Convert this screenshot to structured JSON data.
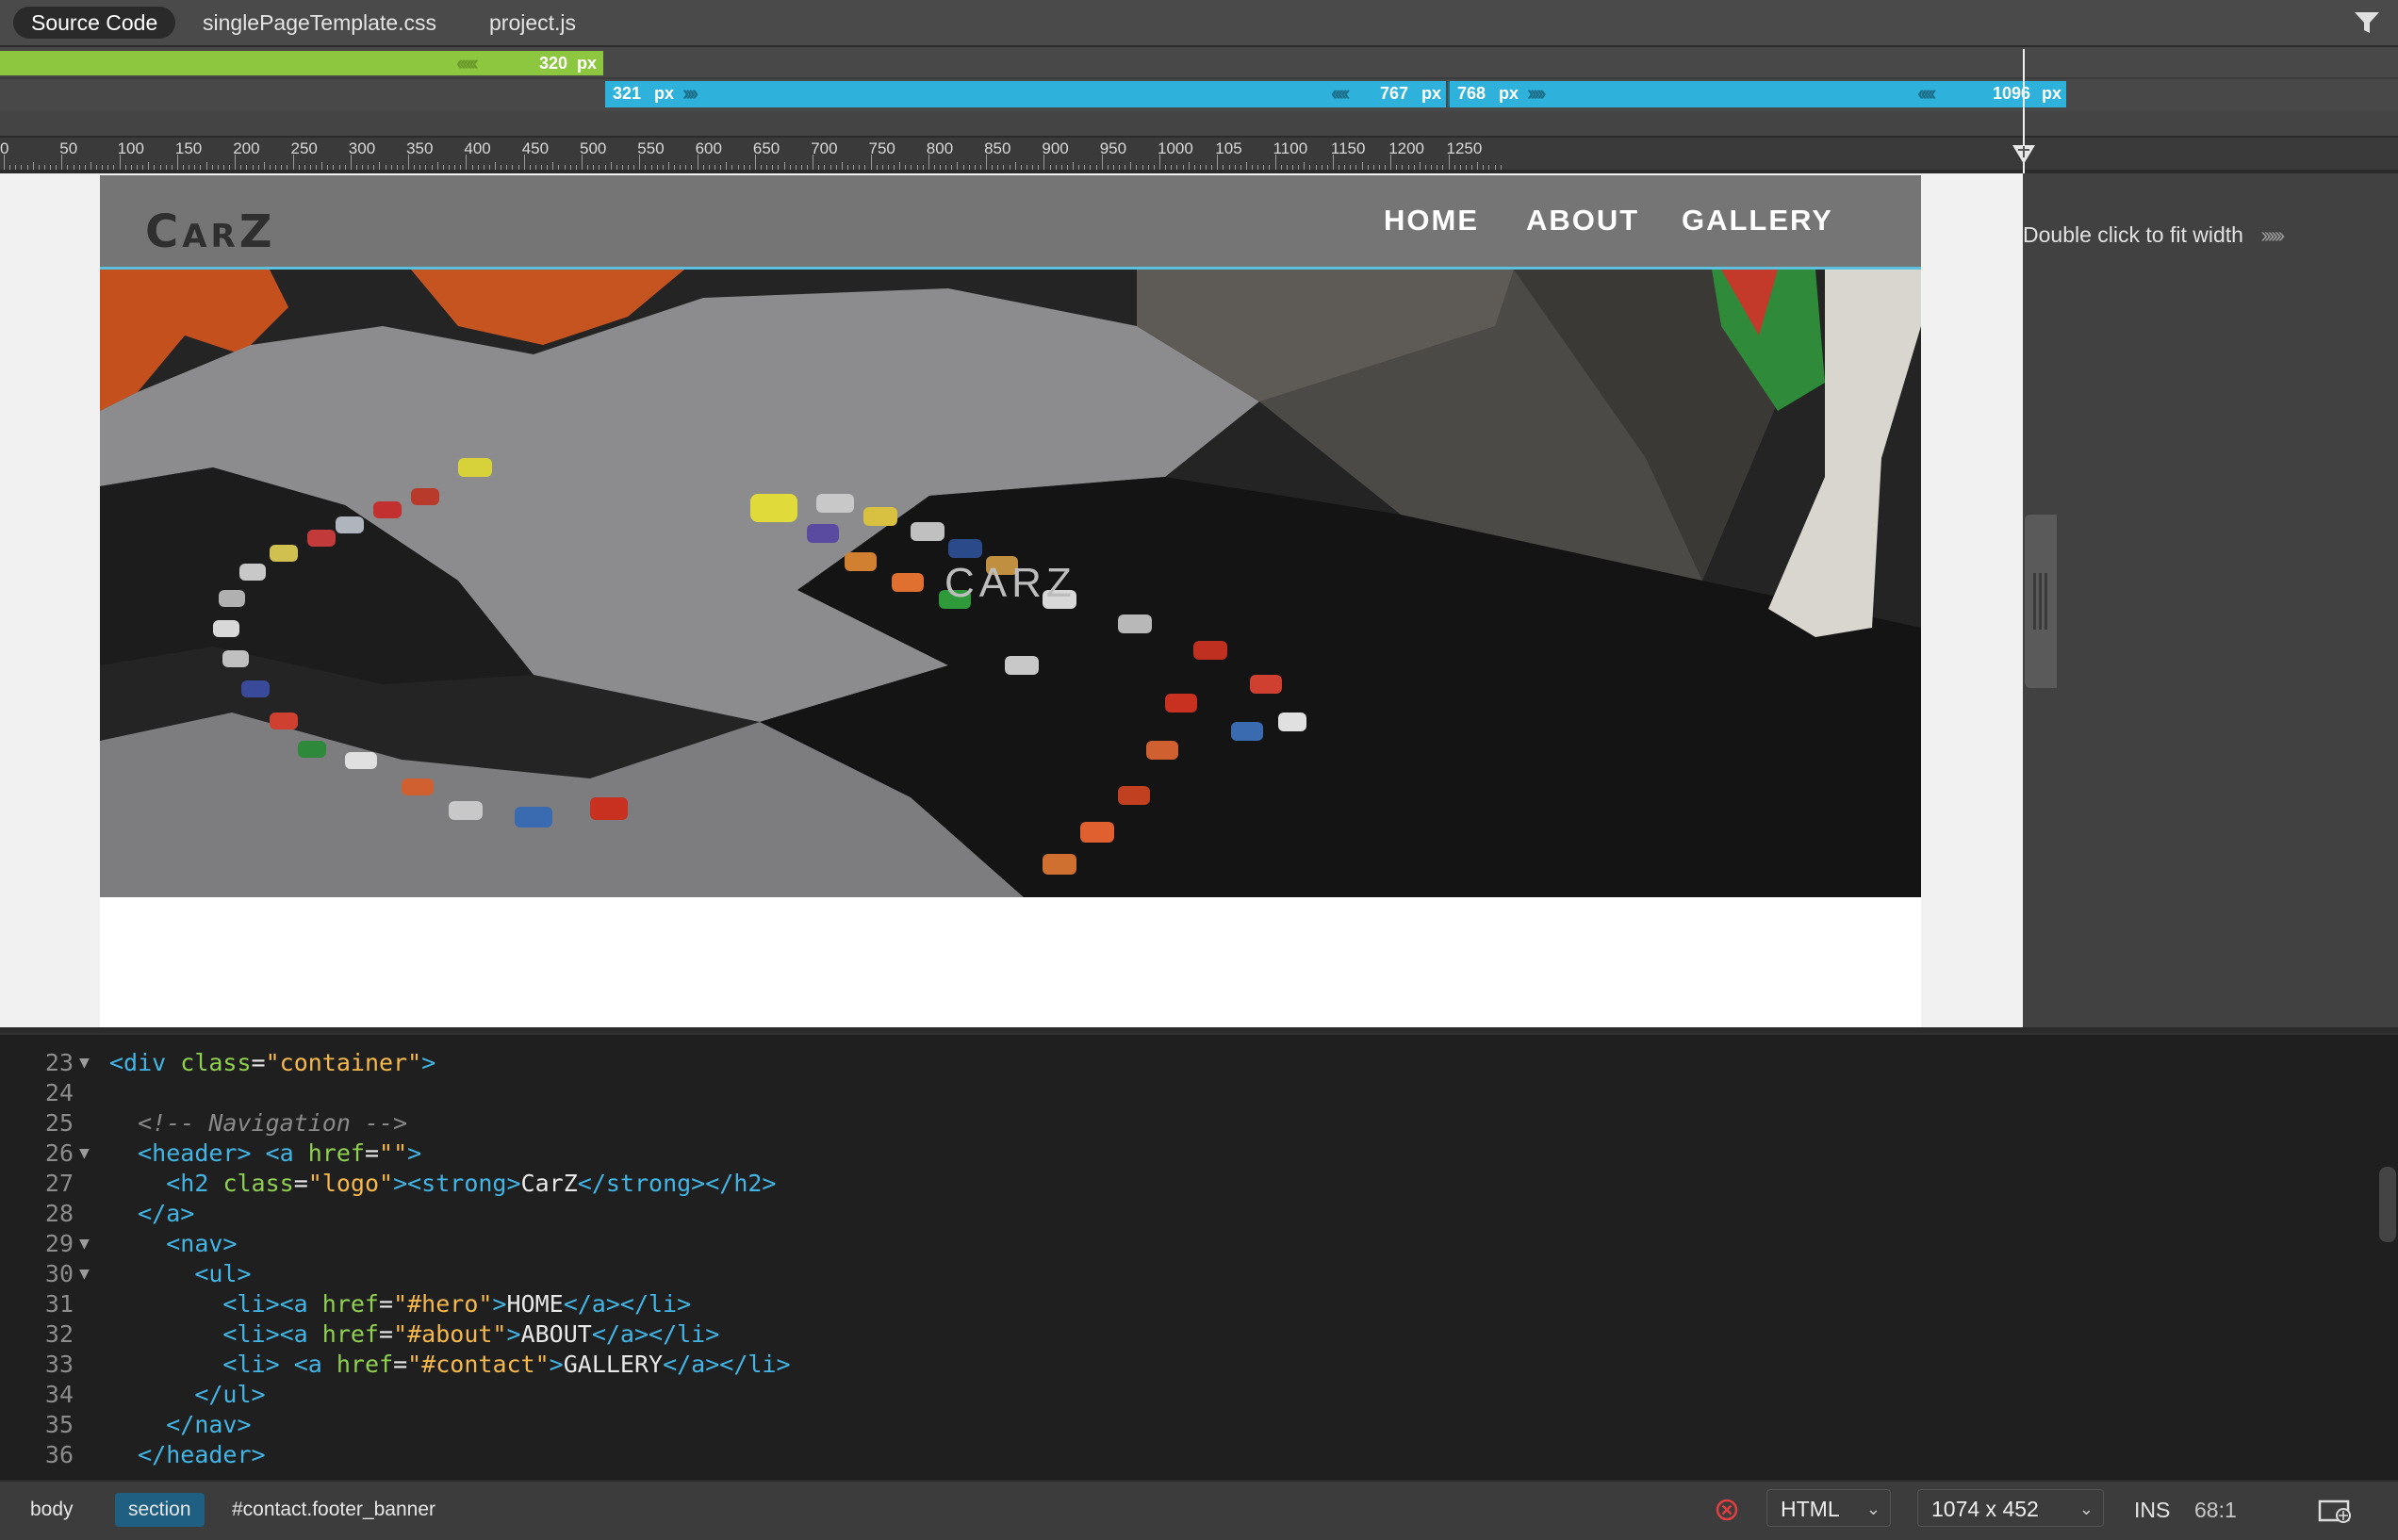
{
  "tabs": [
    {
      "label": "Source Code",
      "active": true
    },
    {
      "label": "singlePageTemplate.css",
      "active": false
    },
    {
      "label": "project.js",
      "active": false
    }
  ],
  "media_queries": {
    "green_label": "320",
    "blue_a_start": "321",
    "blue_a_end": "767",
    "blue_b_start": "768",
    "blue_b_end": "1096",
    "unit": "px"
  },
  "ruler": {
    "labels": [
      "0",
      "50",
      "100",
      "150",
      "200",
      "250",
      "300",
      "350",
      "400",
      "450",
      "500",
      "550",
      "600",
      "650",
      "700",
      "750",
      "800",
      "850",
      "900",
      "950",
      "1000",
      "105",
      "1100",
      "1150",
      "1200",
      "1250"
    ]
  },
  "preview": {
    "fit_hint": "Double click to fit width",
    "logo": "CarZ",
    "nav": [
      "HOME",
      "ABOUT",
      "GALLERY"
    ],
    "hero_title": "CARZ"
  },
  "code": [
    {
      "n": "23",
      "fold": true,
      "segs": [
        [
          "t",
          "<div "
        ],
        [
          "a",
          "class"
        ],
        [
          "x",
          "="
        ],
        [
          "s",
          "\"container\""
        ],
        [
          "t",
          ">"
        ]
      ]
    },
    {
      "n": "24",
      "fold": false,
      "segs": []
    },
    {
      "n": "25",
      "fold": false,
      "segs": [
        [
          "x",
          "  "
        ],
        [
          "c",
          "<!-- Navigation -->"
        ]
      ]
    },
    {
      "n": "26",
      "fold": true,
      "segs": [
        [
          "x",
          "  "
        ],
        [
          "t",
          "<header>"
        ],
        [
          "x",
          " "
        ],
        [
          "t",
          "<a "
        ],
        [
          "a",
          "href"
        ],
        [
          "x",
          "="
        ],
        [
          "s",
          "\"\""
        ],
        [
          "t",
          ">"
        ]
      ]
    },
    {
      "n": "27",
      "fold": false,
      "segs": [
        [
          "x",
          "    "
        ],
        [
          "t",
          "<h2 "
        ],
        [
          "a",
          "class"
        ],
        [
          "x",
          "="
        ],
        [
          "s",
          "\"logo\""
        ],
        [
          "t",
          "><strong>"
        ],
        [
          "x",
          "CarZ"
        ],
        [
          "t",
          "</strong></h2>"
        ]
      ]
    },
    {
      "n": "28",
      "fold": false,
      "segs": [
        [
          "x",
          "  "
        ],
        [
          "t",
          "</a>"
        ]
      ]
    },
    {
      "n": "29",
      "fold": true,
      "segs": [
        [
          "x",
          "    "
        ],
        [
          "t",
          "<nav>"
        ]
      ]
    },
    {
      "n": "30",
      "fold": true,
      "segs": [
        [
          "x",
          "      "
        ],
        [
          "t",
          "<ul>"
        ]
      ]
    },
    {
      "n": "31",
      "fold": false,
      "segs": [
        [
          "x",
          "        "
        ],
        [
          "t",
          "<li><a "
        ],
        [
          "a",
          "href"
        ],
        [
          "x",
          "="
        ],
        [
          "s",
          "\"#hero\""
        ],
        [
          "t",
          ">"
        ],
        [
          "x",
          "HOME"
        ],
        [
          "t",
          "</a></li>"
        ]
      ]
    },
    {
      "n": "32",
      "fold": false,
      "segs": [
        [
          "x",
          "        "
        ],
        [
          "t",
          "<li><a "
        ],
        [
          "a",
          "href"
        ],
        [
          "x",
          "="
        ],
        [
          "s",
          "\"#about\""
        ],
        [
          "t",
          ">"
        ],
        [
          "x",
          "ABOUT"
        ],
        [
          "t",
          "</a></li>"
        ]
      ]
    },
    {
      "n": "33",
      "fold": false,
      "segs": [
        [
          "x",
          "        "
        ],
        [
          "t",
          "<li>"
        ],
        [
          "x",
          " "
        ],
        [
          "t",
          "<a "
        ],
        [
          "a",
          "href"
        ],
        [
          "x",
          "="
        ],
        [
          "s",
          "\"#contact\""
        ],
        [
          "t",
          ">"
        ],
        [
          "x",
          "GALLERY"
        ],
        [
          "t",
          "</a></li>"
        ]
      ]
    },
    {
      "n": "34",
      "fold": false,
      "segs": [
        [
          "x",
          "      "
        ],
        [
          "t",
          "</ul>"
        ]
      ]
    },
    {
      "n": "35",
      "fold": false,
      "segs": [
        [
          "x",
          "    "
        ],
        [
          "t",
          "</nav>"
        ]
      ]
    },
    {
      "n": "36",
      "fold": false,
      "segs": [
        [
          "x",
          "  "
        ],
        [
          "t",
          "</header>"
        ]
      ]
    }
  ],
  "statusbar": {
    "crumbs": [
      "body",
      "section",
      "#contact.footer_banner"
    ],
    "language": "HTML",
    "window_size": "1074 x 452",
    "mode": "INS",
    "cursor": "68:1"
  },
  "colors": {
    "green_bar": "#8dc63f",
    "blue_bar": "#2eb2dc",
    "header_bg": "#757575",
    "header_border": "#5bc0de",
    "section_crumb": "#1e5f82"
  }
}
